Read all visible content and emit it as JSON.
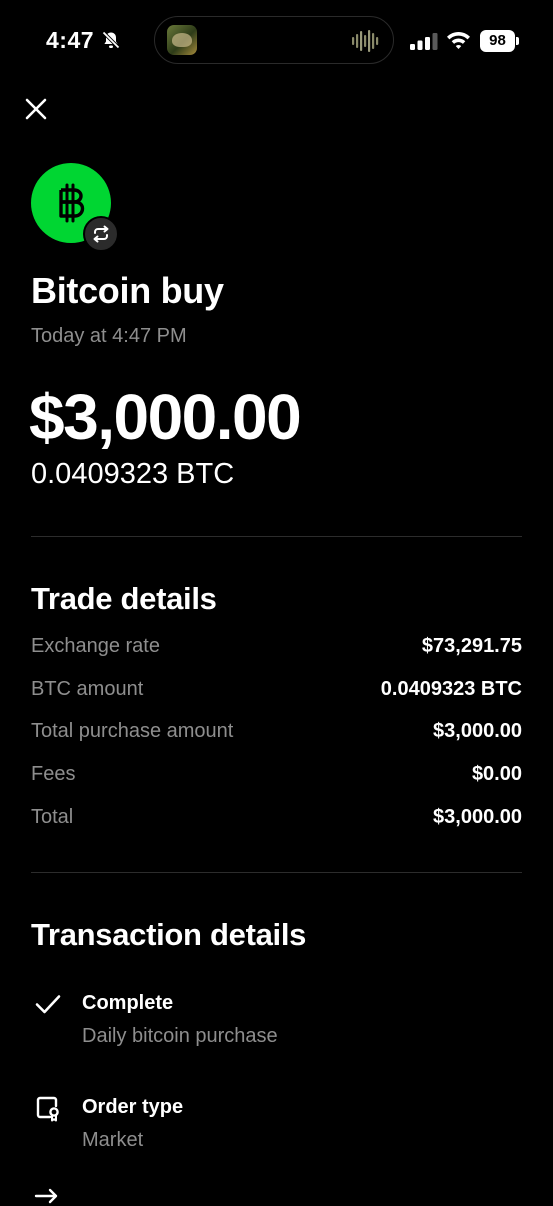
{
  "status_bar": {
    "time": "4:47",
    "battery_level": "98",
    "icons": [
      "bell-off-icon",
      "signal-icon",
      "wifi-icon",
      "battery-icon",
      "audio-wave-icon"
    ]
  },
  "header": {
    "close_icon": "close-icon",
    "avatar_icon": "bitcoin-icon",
    "avatar_badge_icon": "exchange-icon",
    "avatar_color": "#00d632",
    "title": "Bitcoin buy",
    "timestamp": "Today at 4:47 PM",
    "amount": "$3,000.00",
    "btc_amount": "0.0409323 BTC"
  },
  "trade_details": {
    "title": "Trade details",
    "rows": [
      {
        "label": "Exchange rate",
        "value": "$73,291.75"
      },
      {
        "label": "BTC amount",
        "value": "0.0409323 BTC"
      },
      {
        "label": "Total purchase amount",
        "value": "$3,000.00"
      },
      {
        "label": "Fees",
        "value": "$0.00"
      },
      {
        "label": "Total",
        "value": "$3,000.00"
      }
    ]
  },
  "transaction_details": {
    "title": "Transaction details",
    "items": [
      {
        "icon": "checkmark-icon",
        "title": "Complete",
        "detail": "Daily bitcoin purchase"
      },
      {
        "icon": "order-type-icon",
        "title": "Order type",
        "detail": "Market"
      }
    ]
  }
}
